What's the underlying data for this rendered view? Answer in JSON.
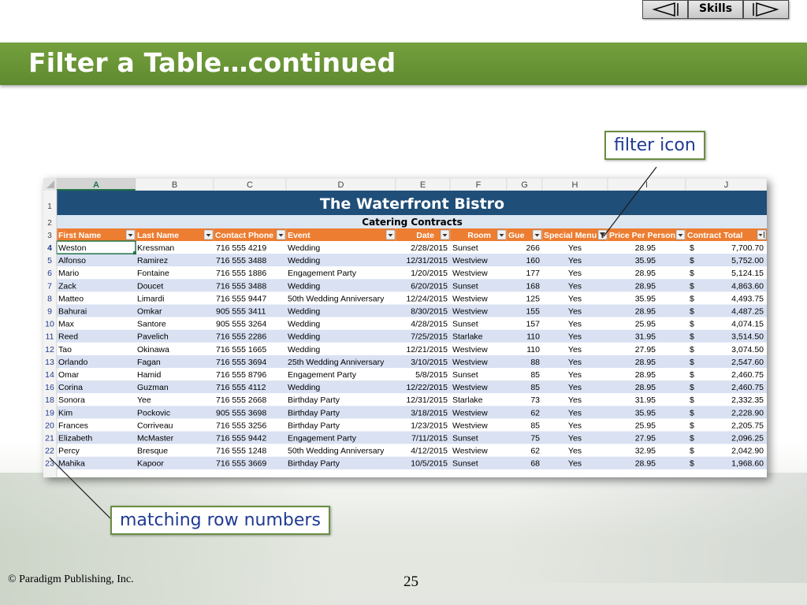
{
  "slide": {
    "title": "Filter a Table…continued",
    "callout_filter": "filter icon",
    "callout_rows": "matching row numbers",
    "copyright": "© Paradigm Publishing, Inc.",
    "page_number": "25",
    "nav_skills": "Skills"
  },
  "colors": {
    "title_bar": "#6b9637",
    "banner_dark": "#1f4e79",
    "banner_light": "#dce6f1",
    "header_orange": "#ed7d31",
    "row_band": "#d9e1f2",
    "row_number_blue": "#1f3a93"
  },
  "spreadsheet": {
    "columns": [
      "A",
      "B",
      "C",
      "D",
      "E",
      "F",
      "G",
      "H",
      "I",
      "J"
    ],
    "active_column": "A",
    "banner_title": "The Waterfront Bistro",
    "banner_subtitle": "Catering Contracts",
    "headers": [
      "First Name",
      "Last Name",
      "Contact Phone",
      "Event",
      "Date",
      "Room",
      "Gue",
      "Special Menu",
      "Price Per Person",
      "Contract Total"
    ],
    "filtered_header": "Special Menu",
    "sorted_header": "Contract Total",
    "row_numbers_top": [
      "1",
      "2",
      "3"
    ],
    "rows": [
      {
        "num": "4",
        "cells": [
          "Weston",
          "Kressman",
          "716 555 4219",
          "Wedding",
          "2/28/2015",
          "Sunset",
          "266",
          "Yes",
          "28.95",
          "$",
          "7,700.70"
        ]
      },
      {
        "num": "5",
        "cells": [
          "Alfonso",
          "Ramirez",
          "716 555 3488",
          "Wedding",
          "12/31/2015",
          "Westview",
          "160",
          "Yes",
          "35.95",
          "$",
          "5,752.00"
        ]
      },
      {
        "num": "6",
        "cells": [
          "Mario",
          "Fontaine",
          "716 555 1886",
          "Engagement Party",
          "1/20/2015",
          "Westview",
          "177",
          "Yes",
          "28.95",
          "$",
          "5,124.15"
        ]
      },
      {
        "num": "7",
        "cells": [
          "Zack",
          "Doucet",
          "716 555 3488",
          "Wedding",
          "6/20/2015",
          "Sunset",
          "168",
          "Yes",
          "28.95",
          "$",
          "4,863.60"
        ]
      },
      {
        "num": "8",
        "cells": [
          "Matteo",
          "Limardi",
          "716 555 9447",
          "50th Wedding Anniversary",
          "12/24/2015",
          "Westview",
          "125",
          "Yes",
          "35.95",
          "$",
          "4,493.75"
        ]
      },
      {
        "num": "9",
        "cells": [
          "Bahurai",
          "Omkar",
          "905 555 3411",
          "Wedding",
          "8/30/2015",
          "Westview",
          "155",
          "Yes",
          "28.95",
          "$",
          "4,487.25"
        ]
      },
      {
        "num": "10",
        "cells": [
          "Max",
          "Santore",
          "905 555 3264",
          "Wedding",
          "4/28/2015",
          "Sunset",
          "157",
          "Yes",
          "25.95",
          "$",
          "4,074.15"
        ]
      },
      {
        "num": "11",
        "cells": [
          "Reed",
          "Pavelich",
          "716 555 2286",
          "Wedding",
          "7/25/2015",
          "Starlake",
          "110",
          "Yes",
          "31.95",
          "$",
          "3,514.50"
        ]
      },
      {
        "num": "12",
        "cells": [
          "Tao",
          "Okinawa",
          "716 555 1665",
          "Wedding",
          "12/21/2015",
          "Westview",
          "110",
          "Yes",
          "27.95",
          "$",
          "3,074.50"
        ]
      },
      {
        "num": "13",
        "cells": [
          "Orlando",
          "Fagan",
          "716 555 3694",
          "25th Wedding Anniversary",
          "3/10/2015",
          "Westview",
          "88",
          "Yes",
          "28.95",
          "$",
          "2,547.60"
        ]
      },
      {
        "num": "14",
        "cells": [
          "Omar",
          "Hamid",
          "716 555 8796",
          "Engagement Party",
          "5/8/2015",
          "Sunset",
          "85",
          "Yes",
          "28.95",
          "$",
          "2,460.75"
        ]
      },
      {
        "num": "16",
        "cells": [
          "Corina",
          "Guzman",
          "716 555 4112",
          "Wedding",
          "12/22/2015",
          "Westview",
          "85",
          "Yes",
          "28.95",
          "$",
          "2,460.75"
        ]
      },
      {
        "num": "18",
        "cells": [
          "Sonora",
          "Yee",
          "716 555 2668",
          "Birthday Party",
          "12/31/2015",
          "Starlake",
          "73",
          "Yes",
          "31.95",
          "$",
          "2,332.35"
        ]
      },
      {
        "num": "19",
        "cells": [
          "Kim",
          "Pockovic",
          "905 555 3698",
          "Birthday Party",
          "3/18/2015",
          "Westview",
          "62",
          "Yes",
          "35.95",
          "$",
          "2,228.90"
        ]
      },
      {
        "num": "20",
        "cells": [
          "Frances",
          "Corriveau",
          "716 555 3256",
          "Birthday Party",
          "1/23/2015",
          "Westview",
          "85",
          "Yes",
          "25.95",
          "$",
          "2,205.75"
        ]
      },
      {
        "num": "21",
        "cells": [
          "Elizabeth",
          "McMaster",
          "716 555 9442",
          "Engagement Party",
          "7/11/2015",
          "Sunset",
          "75",
          "Yes",
          "27.95",
          "$",
          "2,096.25"
        ]
      },
      {
        "num": "22",
        "cells": [
          "Percy",
          "Bresque",
          "716 555 1248",
          "50th Wedding Anniversary",
          "4/12/2015",
          "Westview",
          "62",
          "Yes",
          "32.95",
          "$",
          "2,042.90"
        ]
      },
      {
        "num": "23",
        "cells": [
          "Mahika",
          "Kapoor",
          "716 555 3669",
          "Birthday Party",
          "10/5/2015",
          "Sunset",
          "68",
          "Yes",
          "28.95",
          "$",
          "1,968.60"
        ]
      }
    ]
  }
}
